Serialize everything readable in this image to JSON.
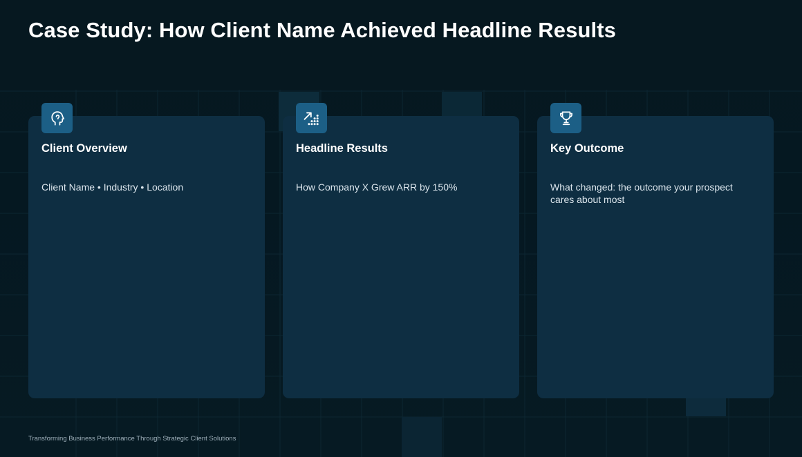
{
  "slide": {
    "title": "Case Study: How Client Name Achieved Headline Results",
    "footer": "Transforming Business Performance Through Strategic Client Solutions"
  },
  "cards": [
    {
      "icon": "head-profile-icon",
      "heading": "Client Overview",
      "text": "Client Name • Industry • Location"
    },
    {
      "icon": "growth-chart-icon",
      "heading": "Headline Results",
      "text": "How Company X Grew ARR by 150%"
    },
    {
      "icon": "trophy-icon",
      "heading": "Key Outcome",
      "text": "What changed: the outcome your prospect cares about most"
    }
  ],
  "colors": {
    "background": "#06161f",
    "card": "#0e2e42",
    "icon_tile": "#1c5f86",
    "title_text": "#ffffff",
    "body_text": "#dbe5ec",
    "footer_text": "#9fb0bb"
  }
}
